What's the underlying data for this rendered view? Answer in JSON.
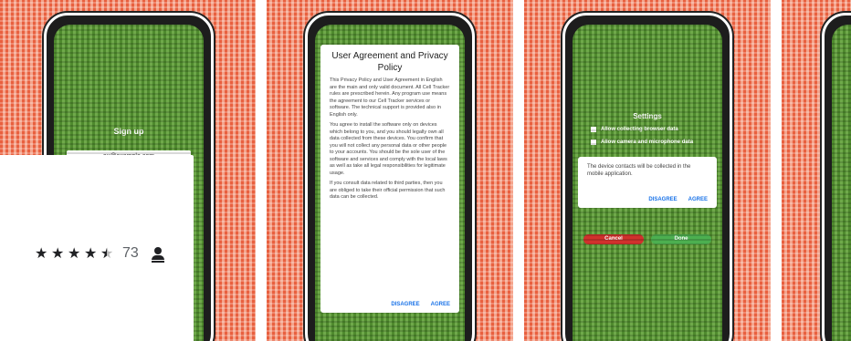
{
  "screenshots": [
    {
      "signup_title": "Sign up",
      "email_value": "ex@example.com"
    },
    {
      "dialog_title": "User Agreement and Privacy Policy",
      "paragraphs": [
        "This Privacy Policy and User Agreement in English are the main and only valid document. All Cell Tracker rules are prescribed herein. Any program use means the agreement to our Cell Tracker services or software. The technical support is provided also in English only.",
        "You agree to install the software only on devices which belong to you, and you should legally own all data collected from these devices. You confirm that you will not collect any personal data or other people to your accounts. You should be the sole user of the software and services and comply with the local laws as well as take all legal responsibilities for legitimate usage.",
        "If you consult data related to third parties, then you are obliged to take their official permission that such data can be collected."
      ],
      "disagree_label": "DISAGREE",
      "agree_label": "AGREE"
    },
    {
      "settings_title": "Settings",
      "option1": "Allow collecting browser data",
      "option2": "Allow camera and microphone data",
      "dialog_text": "The device contacts will be collected in the mobile application.",
      "disagree_label": "DISAGREE",
      "agree_label": "AGREE",
      "cancel_label": "Cancel",
      "done_label": "Done"
    }
  ],
  "rating": {
    "value": 4.5,
    "count": "73",
    "stars": [
      "★",
      "★",
      "★",
      "★"
    ]
  },
  "colors": {
    "background_red": "#e8603f",
    "screen_green": "#4f8a2e",
    "cancel_red": "#d0312d",
    "done_green": "#4caf50",
    "accent_blue": "#1a73e8"
  }
}
